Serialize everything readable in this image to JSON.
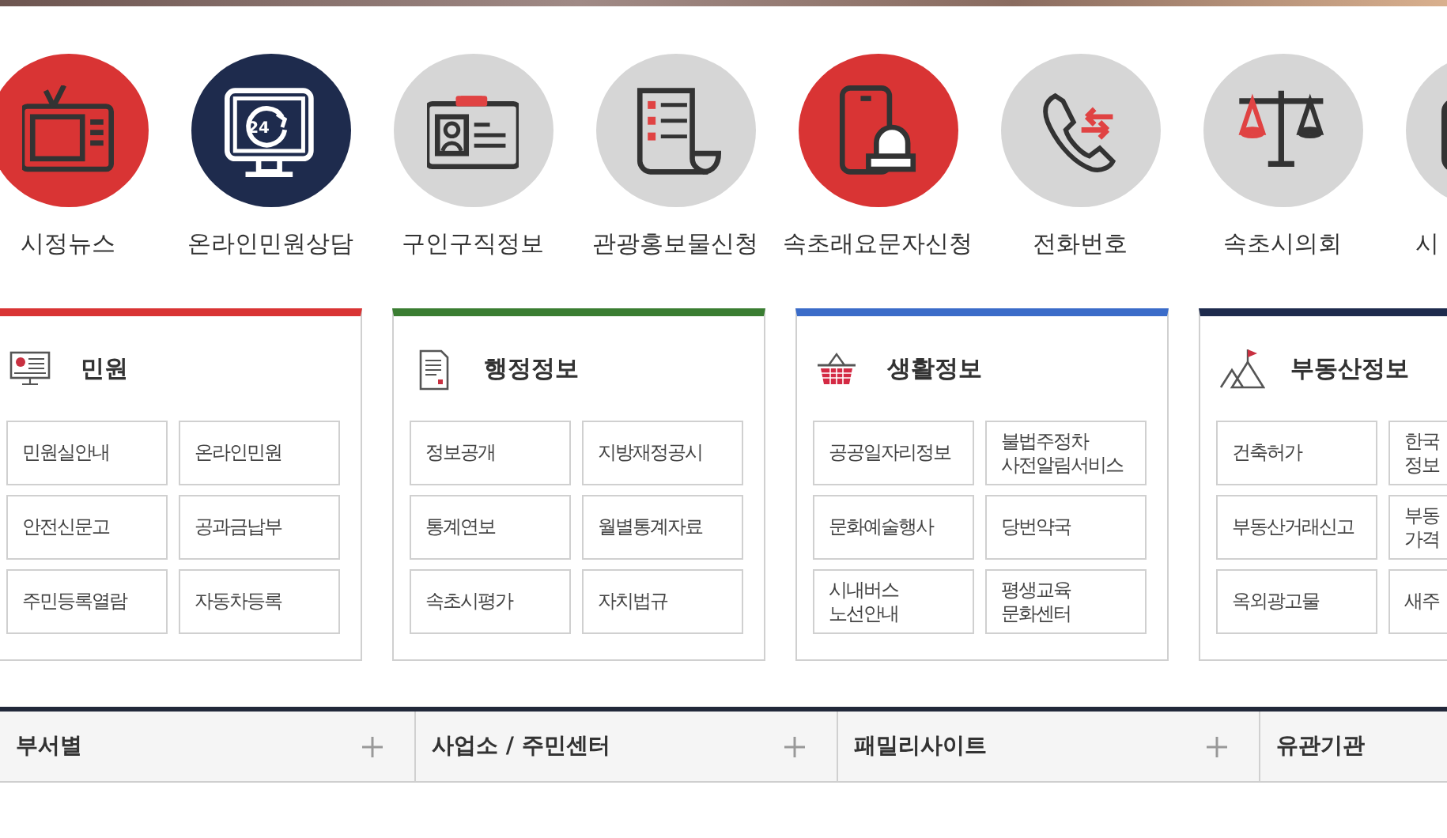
{
  "quick_links": [
    {
      "label": "시정뉴스",
      "kind": "tv",
      "color": "#d93434"
    },
    {
      "label": "온라인민원상담",
      "kind": "monitor24",
      "icon_text": "24",
      "color": "#1e2b4d"
    },
    {
      "label": "구인구직정보",
      "kind": "idcard",
      "color": "#d6d6d6"
    },
    {
      "label": "관광홍보물신청",
      "kind": "scroll",
      "color": "#d6d6d6"
    },
    {
      "label": "속초래요문자신청",
      "kind": "phonealert",
      "color": "#d93434"
    },
    {
      "label": "전화번호",
      "kind": "phone",
      "color": "#d6d6d6"
    },
    {
      "label": "속초시의회",
      "kind": "scales",
      "color": "#d6d6d6"
    },
    {
      "label": "시",
      "kind": "square",
      "color": "#d6d6d6"
    }
  ],
  "cards": [
    {
      "title": "민원",
      "kind": "monitor",
      "color": "#d93434",
      "links": [
        "민원실안내",
        "온라인민원",
        "안전신문고",
        "공과금납부",
        "주민등록열람",
        "자동차등록"
      ]
    },
    {
      "title": "행정정보",
      "kind": "document",
      "color": "#3a7d32",
      "links": [
        "정보공개",
        "지방재정공시",
        "통계연보",
        "월별통계자료",
        "속초시평가",
        "자치법규"
      ]
    },
    {
      "title": "생활정보",
      "kind": "basket",
      "color": "#3b6cc9",
      "links": [
        "공공일자리정보",
        "불법주정차\n사전알림서비스",
        "문화예술행사",
        "당번약국",
        "시내버스\n노선안내",
        "평생교육\n문화센터"
      ]
    },
    {
      "title": "부동산정보",
      "kind": "mountain",
      "color": "#1e2b4d",
      "links": [
        "건축허가",
        "한국\n정보",
        "부동산거래신고",
        "부동\n가격",
        "옥외광고물",
        "새주"
      ]
    }
  ],
  "footer": [
    {
      "label": "부서별"
    },
    {
      "label": "사업소 / 주민센터"
    },
    {
      "label": "패밀리사이트"
    },
    {
      "label": "유관기관"
    }
  ]
}
